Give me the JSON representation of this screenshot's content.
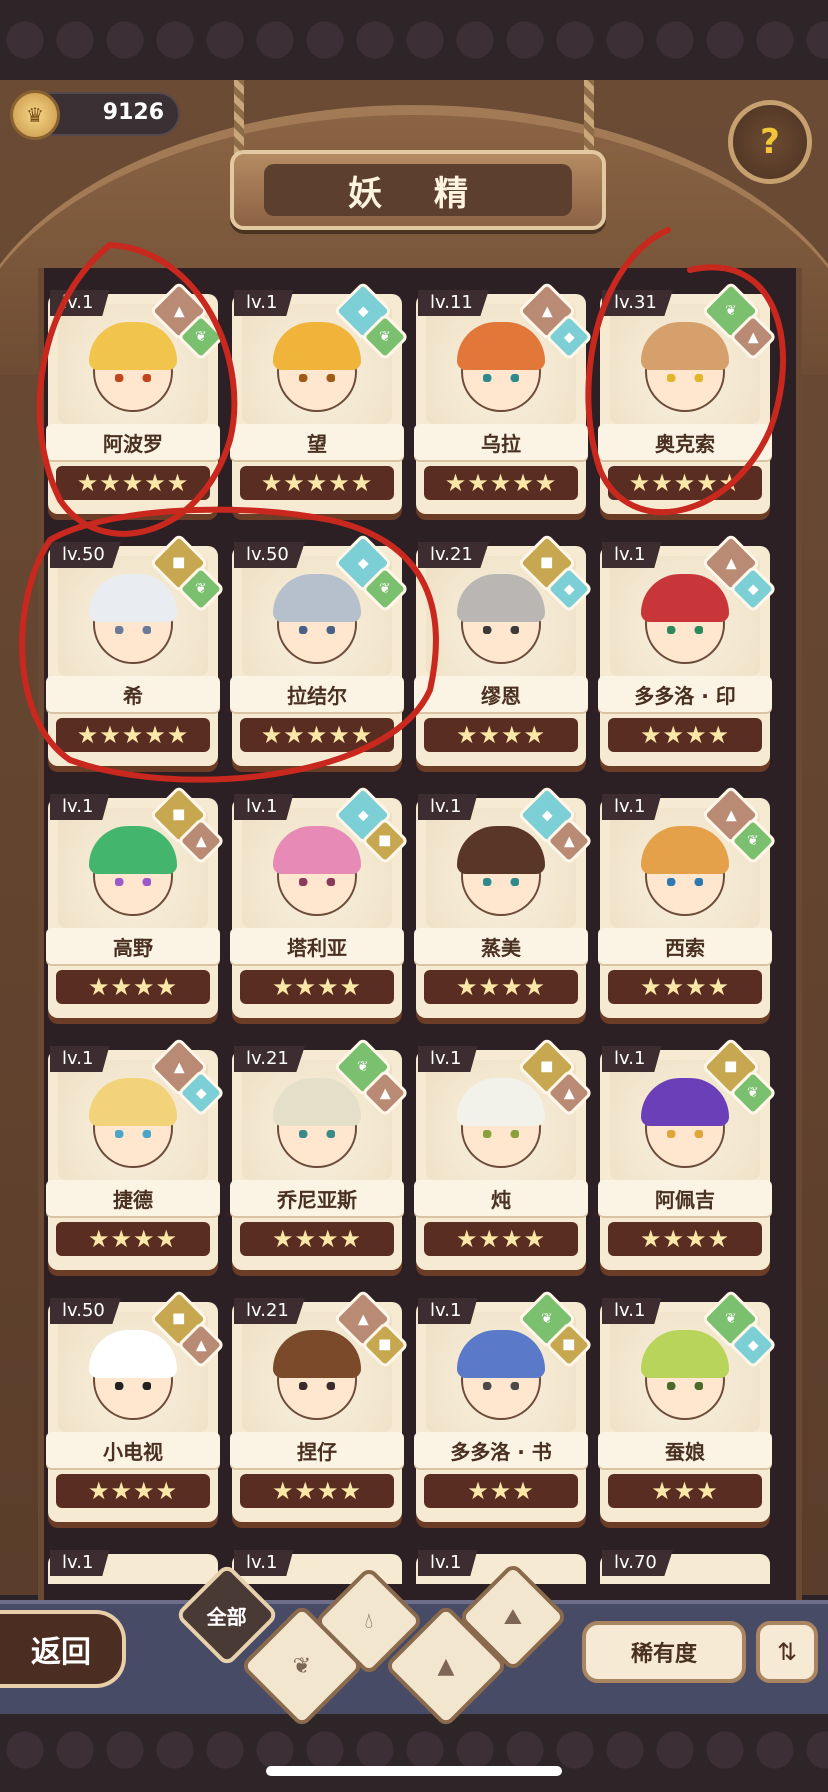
{
  "currency": {
    "value": "9126",
    "icon": "gold-coin-icon"
  },
  "title": "妖 精",
  "help_icon": "question-icon",
  "cards": [
    {
      "lv": "lv.1",
      "name": "阿波罗",
      "stars": "★★★★★",
      "elements": [
        "mountain",
        "leaf"
      ],
      "hair": "#f1c44b",
      "eye": "#c0461e"
    },
    {
      "lv": "lv.1",
      "name": "望",
      "stars": "★★★★★",
      "elements": [
        "water",
        "leaf"
      ],
      "hair": "#f0b43a",
      "eye": "#a05b14"
    },
    {
      "lv": "lv.11",
      "name": "乌拉",
      "stars": "★★★★★",
      "elements": [
        "mountain",
        "water"
      ],
      "hair": "#e2773a",
      "eye": "#2e8a8a"
    },
    {
      "lv": "lv.31",
      "name": "奥克索",
      "stars": "★★★★★",
      "elements": [
        "leaf",
        "mountain"
      ],
      "hair": "#d6a06c",
      "eye": "#e0b52a"
    },
    {
      "lv": "lv.50",
      "name": "希",
      "stars": "★★★★★",
      "elements": [
        "earth",
        "leaf"
      ],
      "hair": "#e9ecf1",
      "eye": "#6c7a9a"
    },
    {
      "lv": "lv.50",
      "name": "拉结尔",
      "stars": "★★★★★",
      "elements": [
        "water",
        "leaf"
      ],
      "hair": "#b6bfcc",
      "eye": "#4a6088"
    },
    {
      "lv": "lv.21",
      "name": "缪恩",
      "stars": "★★★★",
      "elements": [
        "earth",
        "water"
      ],
      "hair": "#b9b6b3",
      "eye": "#3a3a3a"
    },
    {
      "lv": "lv.1",
      "name": "多多洛 · 印",
      "stars": "★★★★",
      "elements": [
        "mountain",
        "water"
      ],
      "hair": "#c9363a",
      "eye": "#2c8a5a"
    },
    {
      "lv": "lv.1",
      "name": "高野",
      "stars": "★★★★",
      "elements": [
        "earth",
        "mountain"
      ],
      "hair": "#44b56c",
      "eye": "#9a58c9"
    },
    {
      "lv": "lv.1",
      "name": "塔利亚",
      "stars": "★★★★",
      "elements": [
        "water",
        "earth"
      ],
      "hair": "#e78ab5",
      "eye": "#8a3a5a"
    },
    {
      "lv": "lv.1",
      "name": "蒸美",
      "stars": "★★★★",
      "elements": [
        "water",
        "mountain"
      ],
      "hair": "#5a3626",
      "eye": "#2e8a8a"
    },
    {
      "lv": "lv.1",
      "name": "西索",
      "stars": "★★★★",
      "elements": [
        "mountain",
        "leaf"
      ],
      "hair": "#e5a04a",
      "eye": "#2e7ab0"
    },
    {
      "lv": "lv.1",
      "name": "捷德",
      "stars": "★★★★",
      "elements": [
        "mountain",
        "water"
      ],
      "hair": "#f2d37a",
      "eye": "#4aa6c9"
    },
    {
      "lv": "lv.21",
      "name": "乔尼亚斯",
      "stars": "★★★★",
      "elements": [
        "leaf",
        "mountain"
      ],
      "hair": "#e4dfc9",
      "eye": "#3a8a8a"
    },
    {
      "lv": "lv.1",
      "name": "炖",
      "stars": "★★★★",
      "elements": [
        "earth",
        "mountain"
      ],
      "hair": "#f2f1ea",
      "eye": "#8aa03a"
    },
    {
      "lv": "lv.1",
      "name": "阿佩吉",
      "stars": "★★★★",
      "elements": [
        "earth",
        "leaf"
      ],
      "hair": "#6a3fb8",
      "eye": "#e0a53a"
    },
    {
      "lv": "lv.50",
      "name": "小电视",
      "stars": "★★★★",
      "elements": [
        "earth",
        "mountain"
      ],
      "hair": "#ffffff",
      "eye": "#222222"
    },
    {
      "lv": "lv.21",
      "name": "捏仔",
      "stars": "★★★★",
      "elements": [
        "mountain",
        "earth"
      ],
      "hair": "#7a4a2a",
      "eye": "#3a2a2a"
    },
    {
      "lv": "lv.1",
      "name": "多多洛 · 书",
      "stars": "★★★",
      "elements": [
        "leaf",
        "earth"
      ],
      "hair": "#5a7ac9",
      "eye": "#4a4a4a"
    },
    {
      "lv": "lv.1",
      "name": "蚕娘",
      "stars": "★★★",
      "elements": [
        "leaf",
        "water"
      ],
      "hair": "#b8d45a",
      "eye": "#4a6a2a"
    }
  ],
  "partial_row": [
    {
      "lv": "lv.1"
    },
    {
      "lv": "lv.1"
    },
    {
      "lv": "lv.1"
    },
    {
      "lv": "lv.70"
    }
  ],
  "bottom": {
    "back_label": "返回",
    "filter_all": "全部",
    "rarity_label": "稀有度",
    "sort_icon": "sort-icon"
  },
  "colors": {
    "mountain": "#b98a74",
    "leaf": "#7bc06e",
    "water": "#7ccfd4",
    "earth": "#c7a74f",
    "annotation": "#c8281e"
  }
}
